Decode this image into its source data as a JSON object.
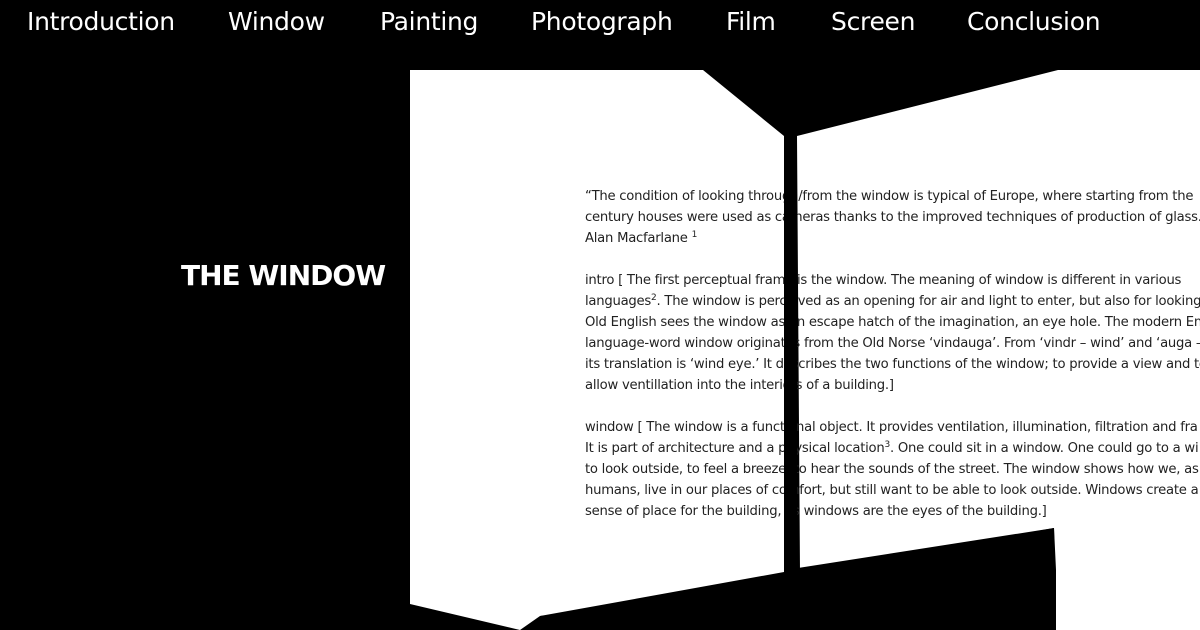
{
  "nav": {
    "items": [
      {
        "label": "Introduction"
      },
      {
        "label": "Window"
      },
      {
        "label": "Painting"
      },
      {
        "label": "Photograph"
      },
      {
        "label": "Film"
      },
      {
        "label": "Screen"
      },
      {
        "label": "Conclusion"
      }
    ]
  },
  "page": {
    "title": "THE WINDOW"
  },
  "content": {
    "quote_line_1": "“The condition of looking through/from the window is typical of Europe, where starting from the",
    "quote_line_2": "century houses were used as cameras thanks to the improved techniques of production of glass.",
    "quote_author": "Alan Macfarlane",
    "quote_footnote": "1",
    "intro_line_1": "intro [ The first perceptual frame is the window. The meaning of window is different in various",
    "intro_line_2_a": "languages",
    "intro_footnote": "2",
    "intro_line_2_b": ". The window is perceived as an opening for air and light to enter, but also for looking",
    "intro_line_3": "Old English sees the window as an escape hatch of the imagination, an eye hole. The modern Eng",
    "intro_line_4": "language-word window originates from the Old Norse ‘vindauga’. From ‘vindr – wind’ and ‘auga –",
    "intro_line_5": "its translation is ‘wind eye.’ It describes the two functions of the window; to provide a view and to",
    "intro_line_6": "allow ventillation into the interiors of a building.]",
    "window_line_1": "window [ The window is a functional object. It provides ventilation, illumination, filtration and fra",
    "window_line_2_a": "It is part of architecture and a physical location",
    "window_footnote": "3",
    "window_line_2_b": ". One could sit in a window. One could go to a wi",
    "window_line_3": "to look outside, to feel a breeze, to hear the sounds of the street. The window shows how we, as",
    "window_line_4": "humans, live in our places of comfort, but still want to be able to look outside. Windows create a",
    "window_line_5": "sense of place for the building, as windows are the eyes of the building.]"
  },
  "colors": {
    "background": "#000000",
    "panel": "#ffffff",
    "text": "#222222",
    "nav_text": "#ffffff"
  }
}
